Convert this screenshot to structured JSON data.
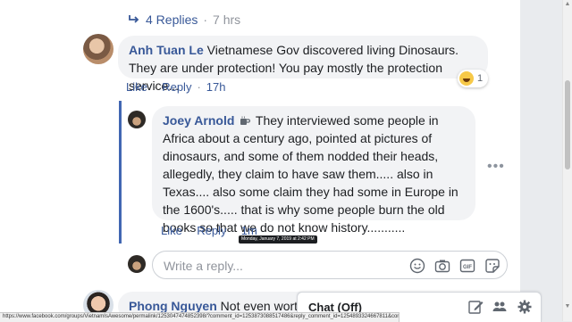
{
  "replies": {
    "label": "4 Replies",
    "separator": "·",
    "time": "7 hrs"
  },
  "comment1": {
    "author": "Anh Tuan Le",
    "text": "Vietnamese Gov discovered living Dinosaurs. They are under protection! You pay mostly the protection service...",
    "reaction_count": "1",
    "like": "Like",
    "reply": "Reply",
    "time": "17h"
  },
  "comment2": {
    "author": "Joey Arnold",
    "text": "They interviewed some people in Africa about a century ago, pointed at pictures of dinosaurs, and some of them nodded their heads, allegedly, they claim to have saw them..... also in Texas.... also some claim they had some in Europe in the 1600's..... that is why some people burn the old books so that we do not know history...........",
    "like": "Like",
    "reply": "Reply",
    "time": "1m",
    "tooltip": "Monday, January 7, 2019 at 2:42 PM"
  },
  "reply_box": {
    "placeholder": "Write a reply..."
  },
  "comment3": {
    "author": "Phong Nguyen",
    "text": "Not even worth t"
  },
  "chat": {
    "title": "Chat (Off)"
  },
  "status_url": "https://www.facebook.com/groups/VietnamIsAwesome/permalink/1253047474852398/?comment_id=1253873088517486&reply_comment_id=1254893324667811&comment_tracking={\"tn\":\"R833\"}",
  "colors": {
    "link": "#385898",
    "thread": "#4267b2",
    "bubble": "#f2f3f5"
  }
}
